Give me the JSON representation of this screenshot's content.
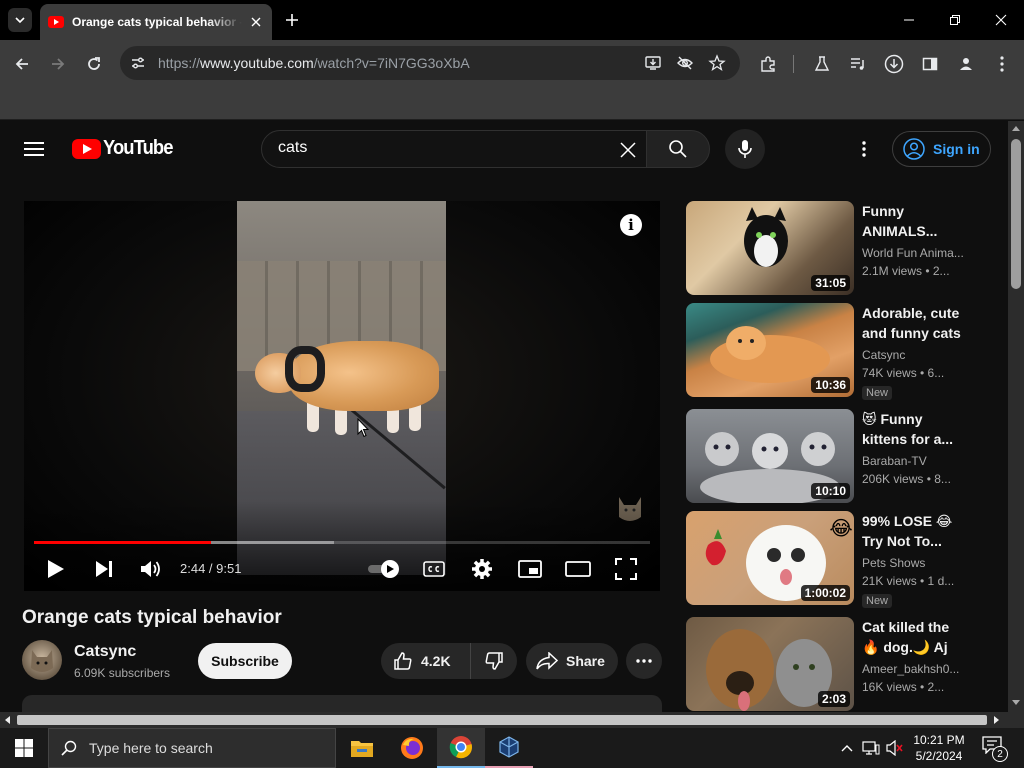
{
  "browser": {
    "tab_title": "Orange cats typical behavior - YouTube",
    "url_prefix": "https://",
    "url_host": "www.youtube.com",
    "url_path": "/watch?v=7iN7GG3oXbA"
  },
  "masthead": {
    "logo_text": "YouTube",
    "search_value": "cats",
    "signin_label": "Sign in"
  },
  "player": {
    "time": "2:44 / 9:51",
    "progress_played_fraction": 0.287,
    "progress_buffered_fraction": 0.487
  },
  "video": {
    "title": "Orange cats typical behavior",
    "channel": "Catsync",
    "subscribers": "6.09K subscribers",
    "subscribe_label": "Subscribe",
    "likes": "4.2K",
    "share_label": "Share"
  },
  "recommendations": [
    {
      "title": "Funny ANIMALS...",
      "channel": "World Fun Anima...",
      "meta": "2.1M views • 2...",
      "duration": "31:05",
      "badge": ""
    },
    {
      "title": "Adorable, cute and funny cats",
      "channel": "Catsync",
      "meta": "74K views • 6...",
      "duration": "10:36",
      "badge": "New"
    },
    {
      "title": "😻 Funny kittens for a...",
      "channel": "Baraban-TV",
      "meta": "206K views • 8...",
      "duration": "10:10",
      "badge": ""
    },
    {
      "title": "99% LOSE 😂 Try Not To...",
      "channel": "Pets Shows",
      "meta": "21K views • 1 d...",
      "duration": "1:00:02",
      "badge": "New"
    },
    {
      "title": "Cat killed the🔥 dog.🌙 Aj is...",
      "channel": "Ameer_bakhsh0...",
      "meta": "16K views • 2...",
      "duration": "2:03",
      "badge": ""
    }
  ],
  "taskbar": {
    "search_placeholder": "Type here to search",
    "time": "10:21 PM",
    "date": "5/2/2024",
    "notification_count": "2"
  },
  "colors": {
    "accent_red": "#ff0000",
    "link_blue": "#3ea6ff",
    "background": "#0f0f0f"
  }
}
